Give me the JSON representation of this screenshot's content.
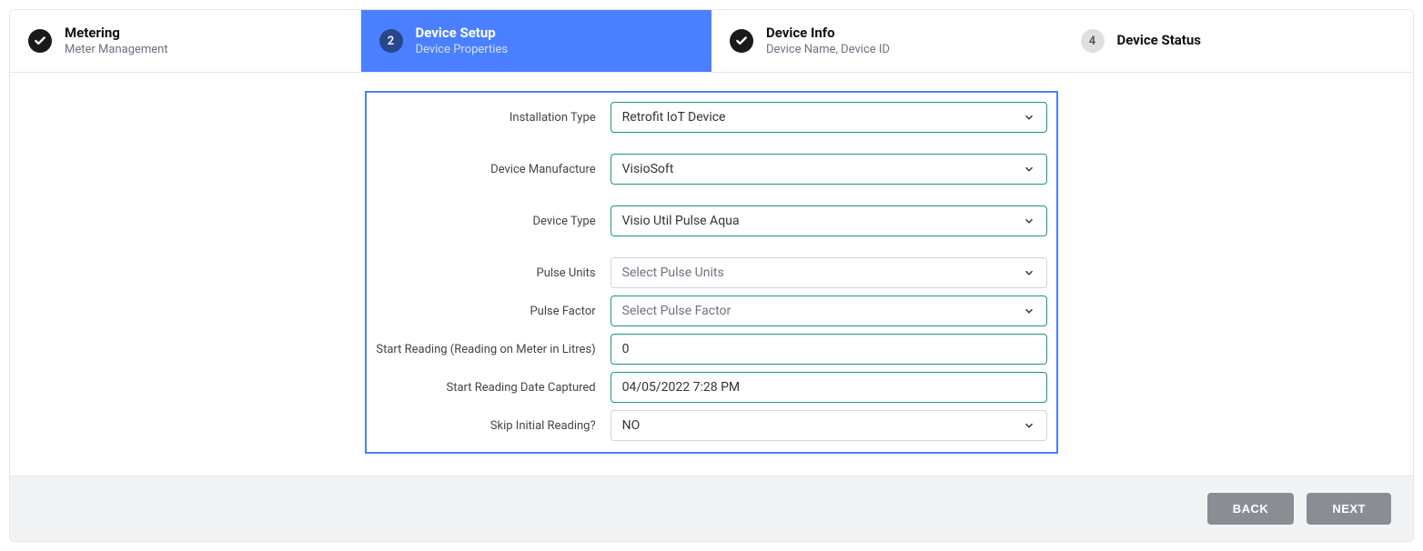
{
  "stepper": {
    "steps": [
      {
        "num": "1",
        "title": "Metering",
        "sub": "Meter Management",
        "state": "done"
      },
      {
        "num": "2",
        "title": "Device Setup",
        "sub": "Device Properties",
        "state": "active"
      },
      {
        "num": "3",
        "title": "Device Info",
        "sub": "Device Name, Device ID",
        "state": "done"
      },
      {
        "num": "4",
        "title": "Device Status",
        "sub": "",
        "state": "upcoming"
      }
    ]
  },
  "form": {
    "installation_type": {
      "label": "Installation Type",
      "value": "Retrofit IoT Device"
    },
    "device_manufacture": {
      "label": "Device Manufacture",
      "value": "VisioSoft"
    },
    "device_type": {
      "label": "Device Type",
      "value": "Visio Util Pulse Aqua"
    },
    "pulse_units": {
      "label": "Pulse Units",
      "value": "Select Pulse Units"
    },
    "pulse_factor": {
      "label": "Pulse Factor",
      "value": "Select Pulse Factor"
    },
    "start_reading": {
      "label": "Start Reading (Reading on Meter in Litres)",
      "value": "0"
    },
    "start_reading_date": {
      "label": "Start Reading Date Captured",
      "value": "04/05/2022 7:28 PM"
    },
    "skip_initial": {
      "label": "Skip Initial Reading?",
      "value": "NO"
    }
  },
  "footer": {
    "back": "BACK",
    "next": "NEXT"
  }
}
